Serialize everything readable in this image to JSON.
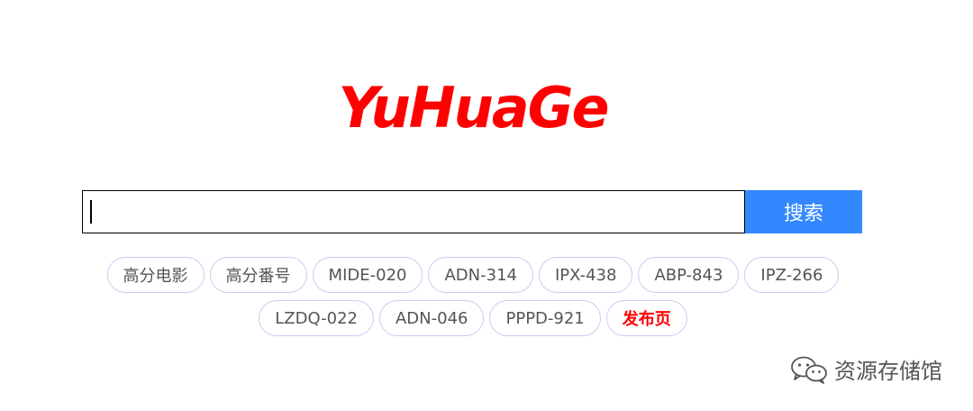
{
  "logo": {
    "text": "YuHuaGe"
  },
  "search": {
    "value": "",
    "placeholder": "",
    "button_label": "搜索"
  },
  "tags": {
    "row1": [
      "高分电影",
      "高分番号",
      "MIDE-020",
      "ADN-314",
      "IPX-438",
      "ABP-843",
      "IPZ-266"
    ],
    "row2": [
      "LZDQ-022",
      "ADN-046",
      "PPPD-921"
    ],
    "publish_label": "发布页"
  },
  "watermark": {
    "icon": "wechat-icon",
    "text": "资源存储馆"
  },
  "colors": {
    "brand": "#ff0000",
    "accent": "#3388ff",
    "tag_border": "#cfcbf2"
  }
}
